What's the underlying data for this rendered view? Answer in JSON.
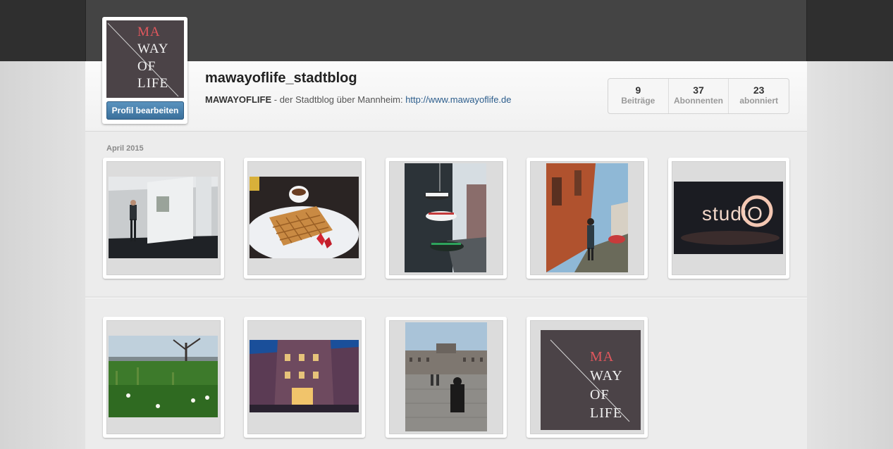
{
  "profile": {
    "username": "mawayoflife_stadtblog",
    "bio_name": "MAWAYOFLIFE",
    "bio_text": " - der Stadtblog über Mannheim: ",
    "bio_link": "http://www.mawayoflife.de",
    "edit_button": "Profil bearbeiten",
    "avatar_logo": [
      "MA",
      "WAY",
      "OF",
      "LIFE"
    ]
  },
  "stats": [
    {
      "value": "9",
      "label": "Beiträge"
    },
    {
      "value": "37",
      "label": "Abonnenten"
    },
    {
      "value": "23",
      "label": "abonniert"
    }
  ],
  "section_label": "April 2015",
  "posts": [
    {
      "subject": "gallery-photo"
    },
    {
      "subject": "waffle-photo"
    },
    {
      "subject": "sneakers-photo"
    },
    {
      "subject": "street-photo"
    },
    {
      "subject": "studio-neon-photo",
      "neon_text": "studiO"
    },
    {
      "subject": "meadow-photo"
    },
    {
      "subject": "building-night-photo"
    },
    {
      "subject": "palace-square-photo"
    },
    {
      "subject": "logo-post-photo",
      "logo": [
        "MA",
        "WAY",
        "OF",
        "LIFE"
      ]
    }
  ],
  "colors": {
    "topbar": "#2f2f2f",
    "button": "#3a6f9a",
    "logo_red": "#e0575d",
    "logo_bg": "#4b4347",
    "link": "#2c5d8c"
  }
}
